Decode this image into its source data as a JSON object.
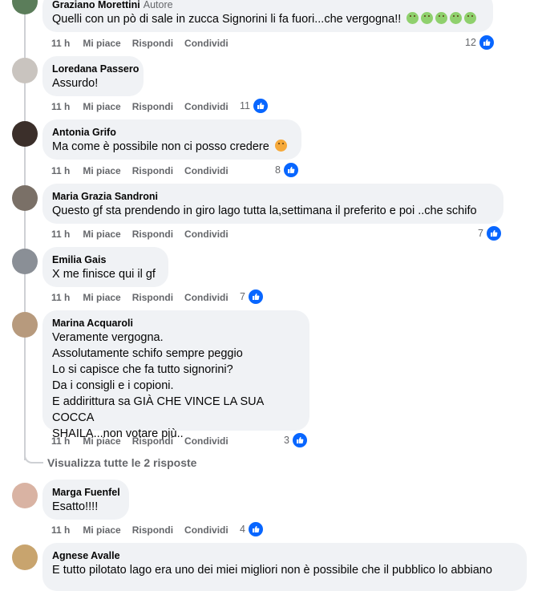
{
  "actions": {
    "time": "11 h",
    "like": "Mi piace",
    "reply": "Rispondi",
    "share": "Condividi"
  },
  "comments": [
    {
      "author": "Graziano Morettini",
      "badge": "Autore",
      "text": "Quelli con un pò di sale in zucca Signorini li fa fuori...che vergogna!!",
      "emoji": [
        "sick-face",
        "sick-face",
        "sick-face",
        "sick-face",
        "sick-face"
      ],
      "likes": "12"
    },
    {
      "author": "Loredana Passero",
      "text": "Assurdo!",
      "likes": "11"
    },
    {
      "author": "Antonia Grifo",
      "text": "Ma come è possibile non ci posso credere",
      "emoji": [
        "sad-face"
      ],
      "likes": "8"
    },
    {
      "author": "Maria Grazia Sandroni",
      "text": "Questo gf sta prendendo in giro lago tutta la,settimana il preferito e poi ..che schifo",
      "likes": "7"
    },
    {
      "author": "Emilia Gais",
      "text": "X me finisce qui il gf",
      "likes": "7"
    },
    {
      "author": "Marina Acquaroli",
      "text": "Veramente vergogna.\nAssolutamente schifo sempre peggio\nLo si capisce che fa tutto signorini?\nDa i consigli e i copioni.\nE addirittura sa GIÀ CHE VINCE LA SUA COCCA\nSHAILA...non votare più..",
      "likes": "3"
    },
    {
      "author": "Marga Fuenfel",
      "text": "Esatto!!!!",
      "likes": "4"
    },
    {
      "author": "Agnese Avalle",
      "text": "E tutto pilotato lago era uno dei miei migliori non è possibile che il pubblico lo abbiano"
    }
  ],
  "view_replies": "Visualizza tutte le 2 risposte",
  "colors": {
    "accent": "#0866ff",
    "bubble": "#f0f2f5",
    "muted": "#65676b"
  }
}
